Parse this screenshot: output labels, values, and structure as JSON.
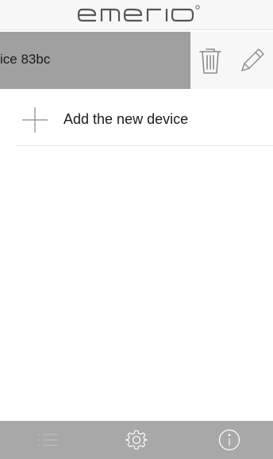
{
  "header": {
    "logo_text": "emerio"
  },
  "device_list": {
    "items": [
      {
        "name_visible": "ice 83bc"
      }
    ],
    "swipe_actions": {
      "delete_icon": "trash-icon",
      "edit_icon": "pencil-icon"
    }
  },
  "add_device": {
    "label": "Add the new device",
    "icon": "plus-icon"
  },
  "tabbar": {
    "tabs": [
      {
        "icon": "list-icon",
        "selected": true
      },
      {
        "icon": "gear-icon",
        "selected": false
      },
      {
        "icon": "info-icon",
        "selected": false
      }
    ]
  },
  "colors": {
    "header_bg": "#f7f7f7",
    "swiped_row_bg": "#a0a0a0",
    "tabbar_bg": "#a8a8a8",
    "icon_stroke": "#ffffff",
    "text": "#1c1c1c"
  }
}
